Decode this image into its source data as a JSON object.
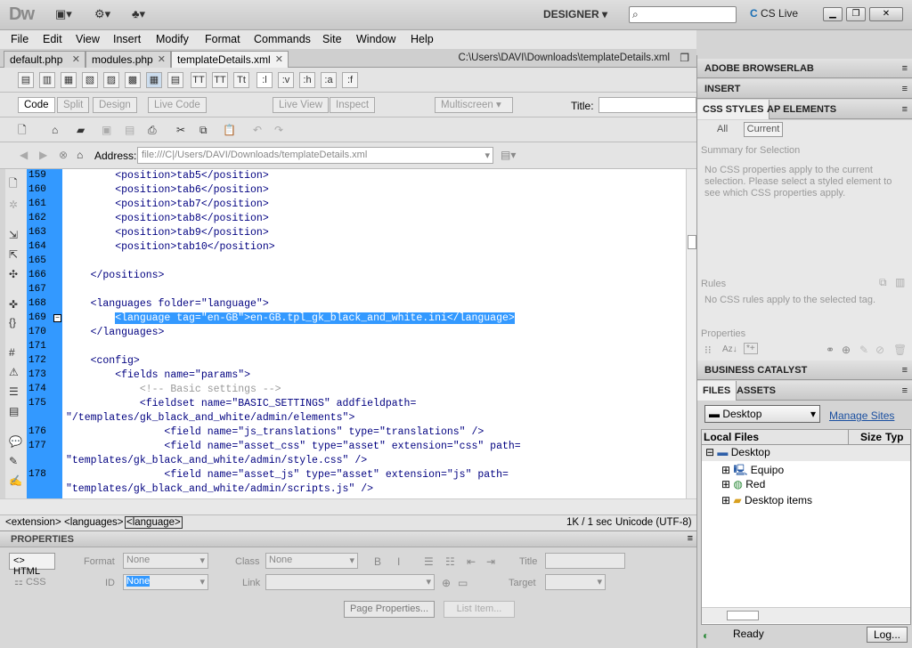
{
  "app": {
    "logo": "Dw",
    "workspace": "DESIGNER",
    "cslive": "CS Live"
  },
  "menu": [
    "File",
    "Edit",
    "View",
    "Insert",
    "Modify",
    "Format",
    "Commands",
    "Site",
    "Window",
    "Help"
  ],
  "doc_tabs": [
    {
      "label": "default.php"
    },
    {
      "label": "modules.php"
    },
    {
      "label": "templateDetails.xml"
    }
  ],
  "doc_path": "C:\\Users\\DAVI\\Downloads\\templateDetails.xml",
  "insert_bar": {
    "buttons": [
      ":l",
      ":v",
      ":h",
      ":a",
      ":f"
    ],
    "text_icons": [
      "TT",
      "TT",
      "Tt"
    ]
  },
  "view_bar": {
    "code": "Code",
    "split": "Split",
    "design": "Design",
    "live_code": "Live Code",
    "live_view": "Live View",
    "inspect": "Inspect",
    "multiscreen": "Multiscreen",
    "title_label": "Title:"
  },
  "address": {
    "label": "Address:",
    "value": "file:///C|/Users/DAVI/Downloads/templateDetails.xml"
  },
  "code_lines": [
    {
      "n": "159",
      "t": "        <position>tab5</position>"
    },
    {
      "n": "160",
      "t": "        <position>tab6</position>"
    },
    {
      "n": "161",
      "t": "        <position>tab7</position>"
    },
    {
      "n": "162",
      "t": "        <position>tab8</position>"
    },
    {
      "n": "163",
      "t": "        <position>tab9</position>"
    },
    {
      "n": "164",
      "t": "        <position>tab10</position>"
    },
    {
      "n": "165",
      "t": ""
    },
    {
      "n": "166",
      "t": "    </positions>"
    },
    {
      "n": "167",
      "t": ""
    },
    {
      "n": "168",
      "t": "    <languages folder=\"language\">"
    },
    {
      "n": "169",
      "t": "        <language tag=\"en-GB\">en-GB.tpl_gk_black_and_white.ini</language>"
    },
    {
      "n": "170",
      "t": "    </languages>"
    },
    {
      "n": "171",
      "t": ""
    },
    {
      "n": "172",
      "t": "    <config>"
    },
    {
      "n": "173",
      "t": "        <fields name=\"params\">"
    },
    {
      "n": "174",
      "t": "            <!-- Basic settings -->"
    },
    {
      "n": "175",
      "t": "            <fieldset name=\"BASIC_SETTINGS\" addfieldpath="
    },
    {
      "n": "",
      "t": "\"/templates/gk_black_and_white/admin/elements\">"
    },
    {
      "n": "176",
      "t": "                <field name=\"js_translations\" type=\"translations\" />"
    },
    {
      "n": "177",
      "t": "                <field name=\"asset_css\" type=\"asset\" extension=\"css\" path="
    },
    {
      "n": "",
      "t": "\"templates/gk_black_and_white/admin/style.css\" />"
    },
    {
      "n": "178",
      "t": "                <field name=\"asset_js\" type=\"asset\" extension=\"js\" path="
    },
    {
      "n": "",
      "t": "\"templates/gk_black_and_white/admin/scripts.js\" />"
    }
  ],
  "tag_selector": [
    "<extension>",
    "<languages>",
    "<language>"
  ],
  "status": {
    "size": "1K / 1 sec",
    "encoding": "Unicode (UTF-8)"
  },
  "properties": {
    "title": "PROPERTIES",
    "html": "HTML",
    "css": "CSS",
    "format_label": "Format",
    "format_value": "None",
    "class_label": "Class",
    "class_value": "None",
    "id_label": "ID",
    "id_value": "None",
    "link_label": "Link",
    "title_label": "Title",
    "target_label": "Target",
    "page_properties": "Page Properties...",
    "list_item": "List Item..."
  },
  "panels": {
    "browserlab": "ADOBE BROWSERLAB",
    "insert": "INSERT",
    "css_styles": "CSS STYLES",
    "ap_elements": "AP ELEMENTS",
    "all": "All",
    "current": "Current",
    "summary": "Summary for Selection",
    "summary_text": "No CSS properties apply to the current selection.  Please select a styled element to see which CSS properties apply.",
    "rules": "Rules",
    "rules_text": "No CSS rules apply to the selected tag.",
    "properties": "Properties",
    "az": "Az↓",
    "business_catalyst": "BUSINESS CATALYST",
    "files": "FILES",
    "assets": "ASSETS",
    "site": "Desktop",
    "manage_sites": "Manage Sites",
    "local_files": "Local Files",
    "size": "Size",
    "type": "Typ",
    "tree": [
      {
        "label": "Desktop",
        "indent": 0,
        "toggle": "⊟"
      },
      {
        "label": "Equipo",
        "indent": 1,
        "toggle": "⊞"
      },
      {
        "label": "Red",
        "indent": 1,
        "toggle": "⊞"
      },
      {
        "label": "Desktop items",
        "indent": 1,
        "toggle": "⊞"
      }
    ],
    "ready": "Ready",
    "log": "Log..."
  }
}
